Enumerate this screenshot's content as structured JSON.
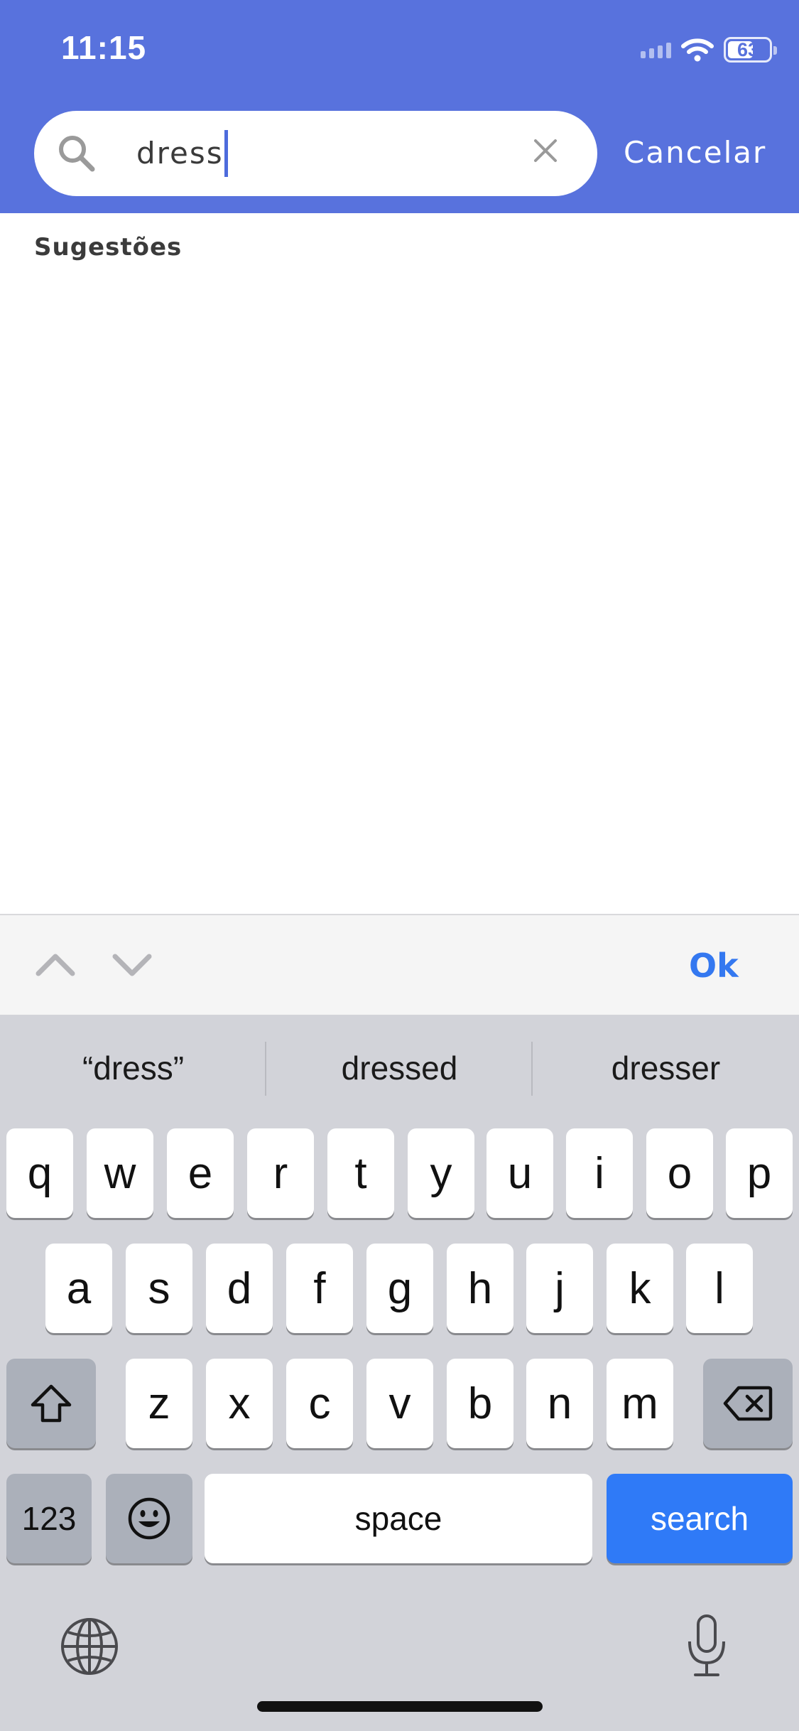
{
  "status_bar": {
    "time": "11:15",
    "battery": "63"
  },
  "search": {
    "value": "dress",
    "cancel_label": "Cancelar"
  },
  "suggestions": {
    "title": "Sugestões"
  },
  "accessory": {
    "ok_label": "Ok"
  },
  "keyboard": {
    "predictions": [
      "“dress”",
      "dressed",
      "dresser"
    ],
    "row1": [
      "q",
      "w",
      "e",
      "r",
      "t",
      "y",
      "u",
      "i",
      "o",
      "p"
    ],
    "row2": [
      "a",
      "s",
      "d",
      "f",
      "g",
      "h",
      "j",
      "k",
      "l"
    ],
    "row3": [
      "z",
      "x",
      "c",
      "v",
      "b",
      "n",
      "m"
    ],
    "numbers_label": "123",
    "space_label": "space",
    "search_label": "search"
  },
  "colors": {
    "header": "#5872dd",
    "accent": "#2f7af7",
    "caret": "#4d6bdc"
  },
  "icons": [
    "search-icon",
    "clear-icon",
    "chevron-up-icon",
    "chevron-down-icon",
    "shift-icon",
    "backspace-icon",
    "emoji-icon",
    "globe-icon",
    "microphone-icon",
    "wifi-icon",
    "battery-icon",
    "signal-icon"
  ]
}
